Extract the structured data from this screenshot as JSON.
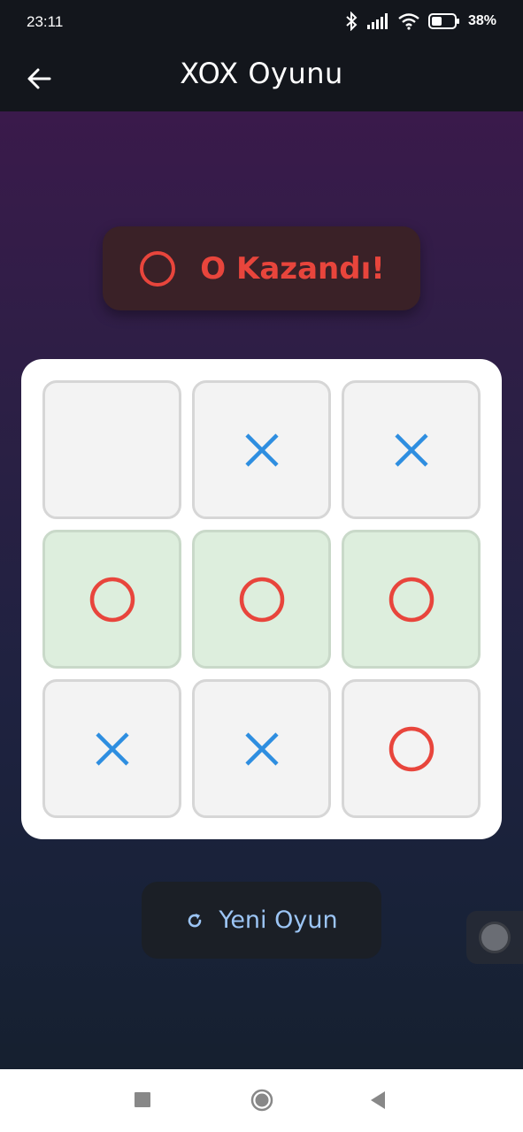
{
  "status_bar": {
    "time": "23:11",
    "battery": "38%",
    "icons": [
      "bluetooth-icon",
      "signal-icon",
      "wifi-icon",
      "battery-icon"
    ]
  },
  "app_bar": {
    "title": "XOX Oyunu",
    "back_icon": "arrow-left-icon"
  },
  "result": {
    "symbol": "O",
    "text": "O Kazandı!",
    "color": "#e8453c"
  },
  "board": {
    "cells": [
      "",
      "X",
      "X",
      "O",
      "O",
      "O",
      "X",
      "X",
      "O"
    ],
    "winning_line": [
      3,
      4,
      5
    ],
    "x_color": "#2e8ee0",
    "o_color": "#e8453c"
  },
  "actions": {
    "new_game_label": "Yeni Oyun",
    "new_game_icon": "refresh-icon"
  },
  "nav": {
    "items": [
      "recents-square-icon",
      "home-circle-icon",
      "back-triangle-icon"
    ]
  }
}
